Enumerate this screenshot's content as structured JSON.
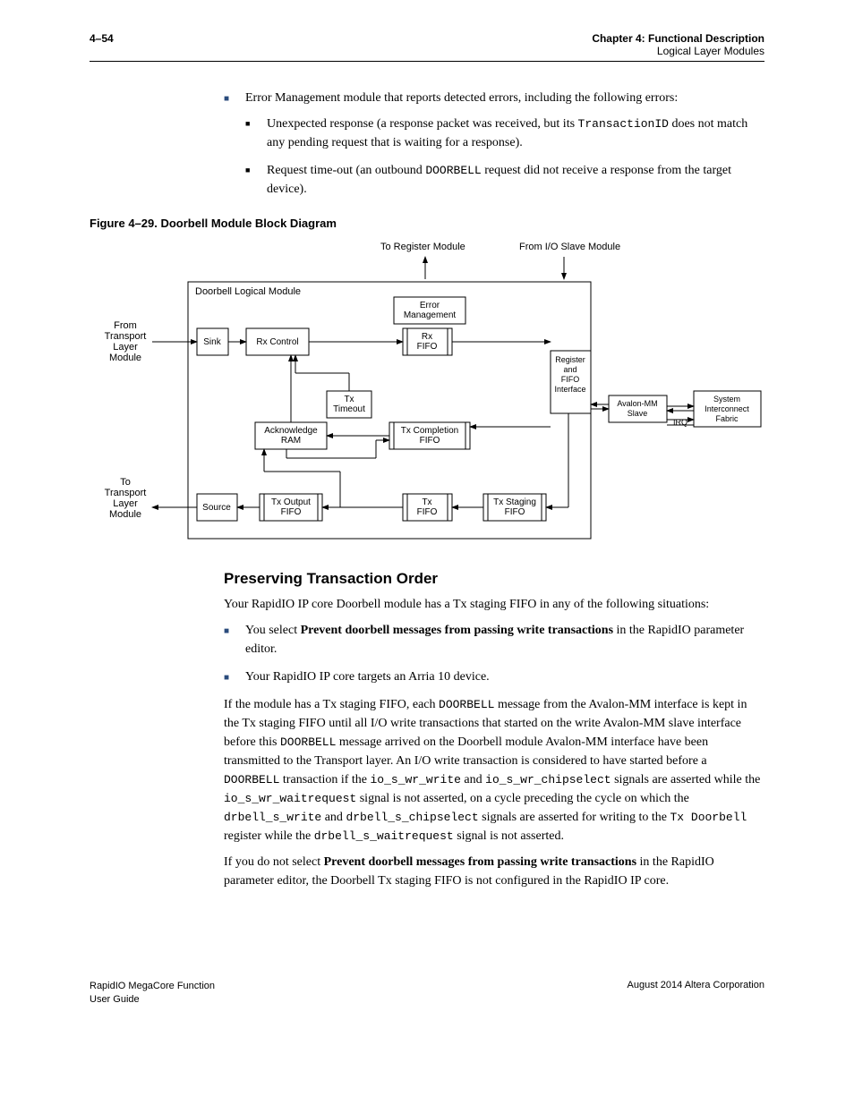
{
  "header": {
    "page_number": "4–54",
    "chapter": "Chapter 4:  Functional Description",
    "section": "Logical Layer Modules"
  },
  "intro_bullets": {
    "item1_prefix": "Error Management module that reports detected errors, including the following errors:",
    "sub1_a": "Unexpected response (a response packet was received, but its ",
    "sub1_code": "TransactionID",
    "sub1_b": " does not match any pending request that is waiting for a response).",
    "sub2_a": "Request time-out (an outbound ",
    "sub2_code": "DOORBELL",
    "sub2_b": " request did not receive a response from the target device)."
  },
  "figure": {
    "caption": "Figure 4–29.  Doorbell Module Block Diagram",
    "labels": {
      "to_register": "To Register Module",
      "from_io_slave": "From I/O Slave Module",
      "doorbell_logical": "Doorbell Logical Module",
      "error_mgmt": "Error\nManagement",
      "from_transport": "From\nTransport\nLayer\nModule",
      "sink": "Sink",
      "rx_control": "Rx Control",
      "rx_fifo": "Rx\nFIFO",
      "register_fifo": "Register\nand\nFIFO\nInterface",
      "avalon_mm": "Avalon-MM\nSlave",
      "system_inter": "System\nInterconnect\nFabric",
      "irq": "IRQ",
      "tx_timeout": "Tx\nTimeout",
      "ack_ram": "Acknowledge\nRAM",
      "tx_completion": "Tx Completion\nFIFO",
      "to_transport": "To\nTransport\nLayer\nModule",
      "source": "Source",
      "tx_output_fifo": "Tx Output\nFIFO",
      "tx_fifo": "Tx\nFIFO",
      "tx_staging": "Tx Staging\nFIFO"
    }
  },
  "section": {
    "heading": "Preserving Transaction Order",
    "p1": "Your RapidIO IP core Doorbell module has a Tx staging FIFO in any of the following situations:",
    "b1_a": "You select ",
    "b1_bold": "Prevent doorbell messages from passing write transactions",
    "b1_b": " in the RapidIO parameter editor.",
    "b2": "Your RapidIO IP core targets an Arria 10 device.",
    "p2_a": "If the module has a Tx staging FIFO, each ",
    "p2_code1": "DOORBELL",
    "p2_b": " message from the Avalon-MM interface is kept in the Tx staging FIFO until all I/O write transactions that started on the write Avalon-MM slave interface before this ",
    "p2_code2": "DOORBELL",
    "p2_c": " message arrived on the Doorbell module Avalon-MM interface have been transmitted to the Transport layer. An I/O write transaction is considered to have started before a ",
    "p2_code3": "DOORBELL",
    "p2_d": " transaction if the ",
    "p2_code4": "io_s_wr_write",
    "p2_e": " and ",
    "p2_code5": "io_s_wr_chipselect",
    "p2_f": " signals are asserted while the ",
    "p2_code6": "io_s_wr_waitrequest",
    "p2_g": " signal is not asserted, on a cycle preceding the cycle on which the ",
    "p2_code7": "drbell_s_write",
    "p2_h": " and ",
    "p2_code8": "drbell_s_chipselect",
    "p2_i": " signals are asserted for writing to the ",
    "p2_code9": "Tx Doorbell",
    "p2_j": " register while the ",
    "p2_code10": "drbell_s_waitrequest",
    "p2_k": " signal is not asserted.",
    "p3_a": "If you do not select ",
    "p3_bold": "Prevent doorbell messages from passing write transactions",
    "p3_b": " in the RapidIO parameter editor, the Doorbell Tx staging FIFO is not configured in the RapidIO IP core."
  },
  "footer": {
    "left_line1": "RapidIO MegaCore Function",
    "left_line2": "User Guide",
    "right": "August 2014   Altera Corporation"
  }
}
